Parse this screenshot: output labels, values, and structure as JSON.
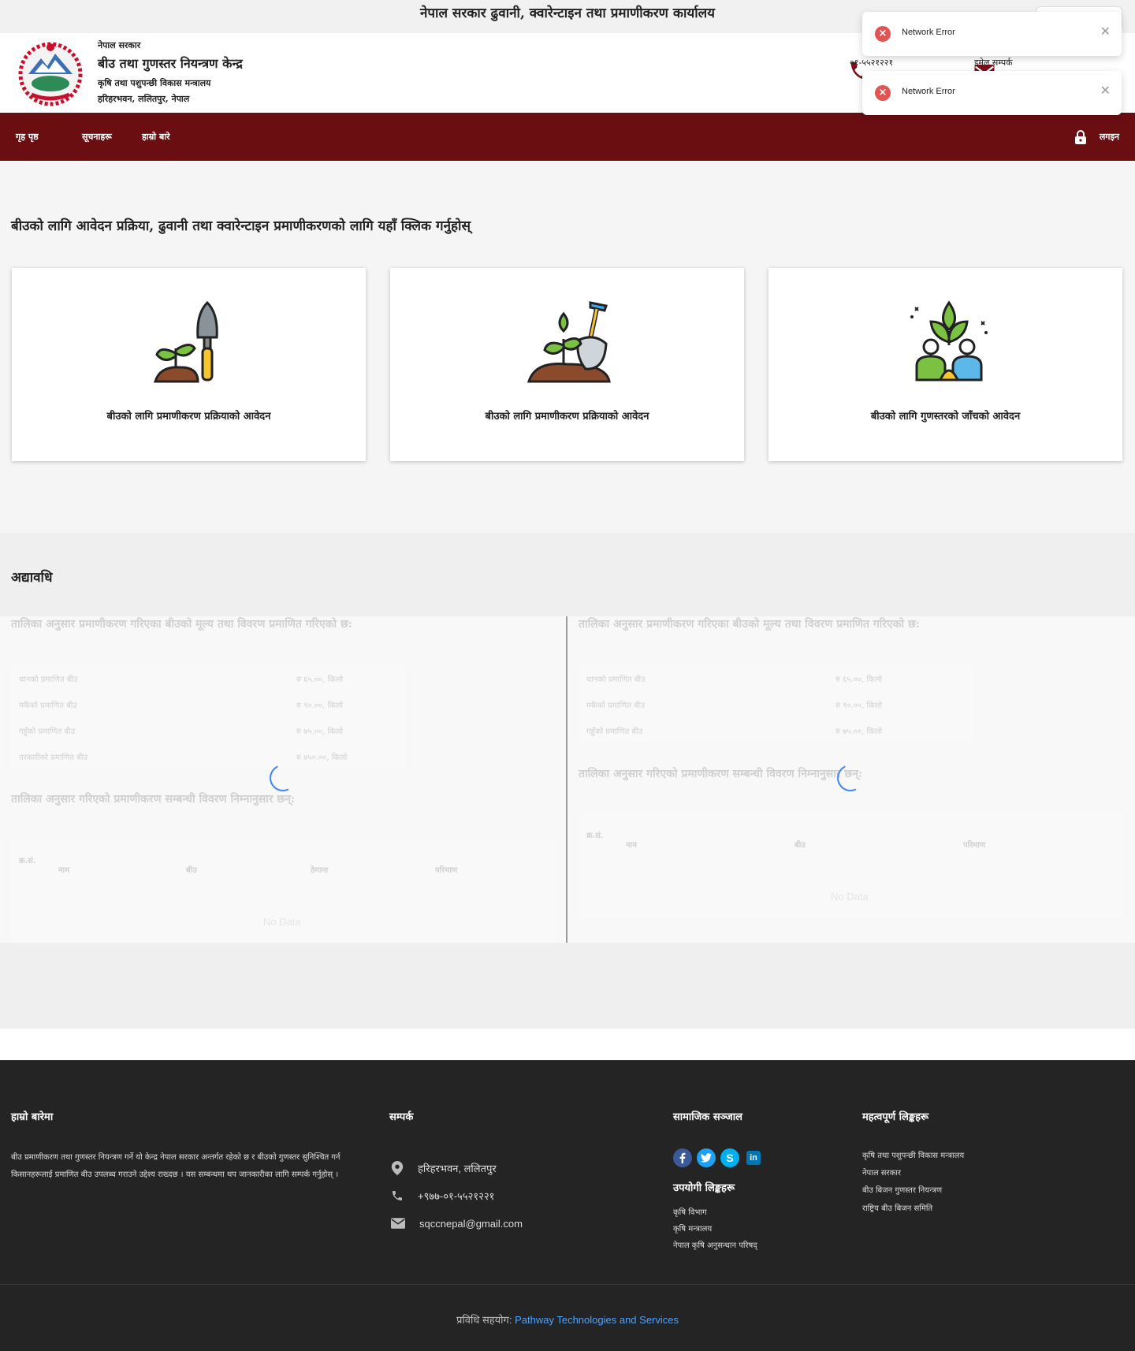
{
  "top_banner": {
    "title": "नेपाल सरकार ढुवानी, क्वारेन्टाइन तथा प्रमाणीकरण कार्यालय"
  },
  "header": {
    "line1": "नेपाल सरकार",
    "line2": "बीउ तथा गुणस्तर नियन्त्रण केन्द्र",
    "line3": "कृषि तथा पशुपन्छी विकास मन्त्रालय",
    "line4": "हरिहरभवन, ललितपुर, नेपाल",
    "phone_label": "०१-५५२१२२१",
    "email_label": "इमेल सम्पर्क"
  },
  "nav": {
    "items": [
      "गृह पृष्ठ",
      "सूचनाहरू",
      "हाम्रो बारे"
    ],
    "login_label": "लगइन"
  },
  "toasts": [
    {
      "message": "Network Error"
    },
    {
      "message": "Network Error"
    }
  ],
  "services": {
    "heading": "बीउको लागि आवेदन प्रक्रिया, ढुवानी तथा क्वारेन्टाइन प्रमाणीकरणको लागि यहाँ क्लिक गर्नुहोस्",
    "cards": [
      {
        "label": "बीउको लागि प्रमाणीकरण प्रक्रियाको आवेदन"
      },
      {
        "label": "बीउको लागि प्रमाणीकरण प्रक्रियाको आवेदन"
      },
      {
        "label": "बीउको लागि गुणस्तरको जाँचको आवेदन"
      }
    ]
  },
  "updates": {
    "heading": "अद्यावधि",
    "left": {
      "rates_title": "तालिका अनुसार प्रमाणीकरण गरिएका बीउको मूल्य तथा विवरण प्रमाणित गरिएको छ:",
      "rates": [
        {
          "name": "धानको प्रमाणित बीउ",
          "value": "रु ६५.००, किलो"
        },
        {
          "name": "मकैको प्रमाणित बीउ",
          "value": "रु ९०.००, किलो"
        },
        {
          "name": "गहुँको प्रमाणित बीउ",
          "value": "रु ७५.००, किलो"
        },
        {
          "name": "तरकारीको प्रमाणित बीउ",
          "value": "रु ४५०.००, किलो"
        }
      ],
      "table_title": "तालिका अनुसार गरिएको प्रमाणीकरण सम्बन्धी विवरण निम्नानुसार छन्:",
      "columns": [
        "क्र.सं.",
        "नाम",
        "बीउ",
        "ठेगाना",
        "परिमाण"
      ],
      "no_data": "No Data"
    },
    "right": {
      "rates_title": "तालिका अनुसार प्रमाणीकरण गरिएका बीउको मूल्य तथा विवरण प्रमाणित गरिएको छ:",
      "rates": [
        {
          "name": "धानको प्रमाणित बीउ",
          "value": "रु ६५.००, किलो"
        },
        {
          "name": "मकैको प्रमाणित बीउ",
          "value": "रु ९०.००, किलो"
        },
        {
          "name": "गहुँको प्रमाणित बीउ",
          "value": "रु ७५.००, किलो"
        }
      ],
      "table_title": "तालिका अनुसार गरिएको प्रमाणीकरण सम्बन्धी विवरण निम्नानुसार छन्:",
      "columns": [
        "क्र.सं.",
        "नाम",
        "बीउ",
        "परिमाण"
      ],
      "no_data": "No Data"
    }
  },
  "footer": {
    "about_title": "हाम्रो बारेमा",
    "about_text": "बीउ प्रमाणीकरण तथा गुणस्तर नियन्त्रण गर्ने यो केन्द्र नेपाल सरकार अन्तर्गत रहेको छ र बीउको गुणस्तर सुनिश्चित गर्न किसानहरूलाई प्रमाणित बीउ उपलब्ध गराउने उद्देश्य राख्दछ । यस सम्बन्धमा थप जानकारीका लागि सम्पर्क गर्नुहोस् ।",
    "contact_title": "सम्पर्क",
    "address": "हरिहरभवन, ललितपुर",
    "phone": "+९७७-०१-५५२१२२१",
    "email": "sqccnepal@gmail.com",
    "social_title": "सामाजिक सञ्जाल",
    "useful_title": "उपयोगी लिङ्कहरू",
    "useful_links": [
      "कृषि विभाग",
      "कृषि मन्त्रालय",
      "नेपाल कृषि अनुसन्धान परिषद्"
    ],
    "important_title": "महत्वपूर्ण लिङ्कहरू",
    "important_links": [
      "कृषि तथा पशुपन्छी विकास मन्त्रालय",
      "नेपाल सरकार",
      "बीउ बिजन गुणस्तर नियन्त्रण",
      "राष्ट्रिय बीउ बिजन समिति"
    ],
    "credit_prefix": "प्रविधि सहयोग:",
    "credit_link": "Pathway Technologies and Services"
  },
  "colors": {
    "nav_bg": "#6b0e12",
    "footer_bg": "#242424",
    "error_red": "#e05554",
    "link_blue": "#4da3ff"
  },
  "icons": [
    "phone-icon",
    "mail-icon",
    "lock-icon",
    "error-icon",
    "close-icon",
    "location-icon",
    "facebook-icon",
    "twitter-icon",
    "skype-icon",
    "linkedin-icon"
  ]
}
